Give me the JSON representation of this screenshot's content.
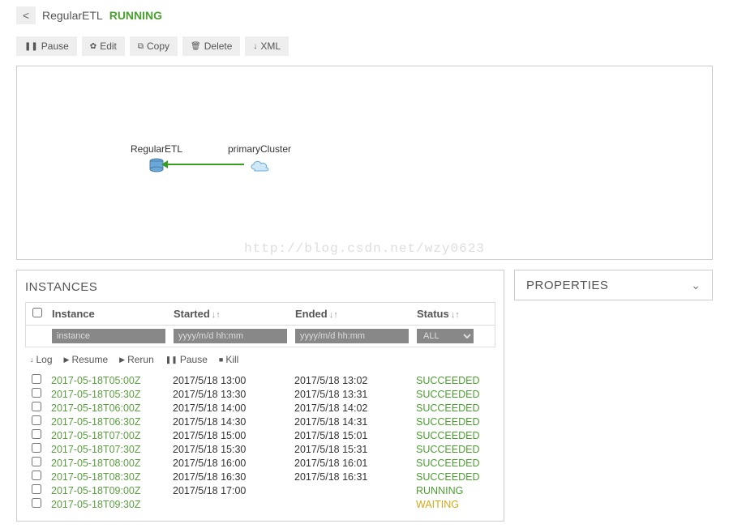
{
  "header": {
    "back_icon": "<",
    "feed_name": "RegularETL",
    "feed_status": "RUNNING"
  },
  "toolbar": {
    "pause": "Pause",
    "edit": "Edit",
    "copy": "Copy",
    "delete": "Delete",
    "xml": "XML"
  },
  "diagram": {
    "node1": "RegularETL",
    "node2": "primaryCluster",
    "watermark": "http://blog.csdn.net/wzy0623"
  },
  "instances_panel": {
    "title": "INSTANCES",
    "columns": {
      "instance": "Instance",
      "started": "Started",
      "ended": "Ended",
      "status": "Status"
    },
    "filters": {
      "instance_placeholder": "instance",
      "started_placeholder": "yyyy/m/d hh:mm",
      "ended_placeholder": "yyyy/m/d hh:mm",
      "status_value": "ALL"
    },
    "actions": {
      "log": "Log",
      "resume": "Resume",
      "rerun": "Rerun",
      "pause": "Pause",
      "kill": "Kill"
    },
    "rows": [
      {
        "id": "2017-05-18T05:00Z",
        "started": "2017/5/18 13:00",
        "ended": "2017/5/18 13:02",
        "status": "SUCCEEDED"
      },
      {
        "id": "2017-05-18T05:30Z",
        "started": "2017/5/18 13:30",
        "ended": "2017/5/18 13:31",
        "status": "SUCCEEDED"
      },
      {
        "id": "2017-05-18T06:00Z",
        "started": "2017/5/18 14:00",
        "ended": "2017/5/18 14:02",
        "status": "SUCCEEDED"
      },
      {
        "id": "2017-05-18T06:30Z",
        "started": "2017/5/18 14:30",
        "ended": "2017/5/18 14:31",
        "status": "SUCCEEDED"
      },
      {
        "id": "2017-05-18T07:00Z",
        "started": "2017/5/18 15:00",
        "ended": "2017/5/18 15:01",
        "status": "SUCCEEDED"
      },
      {
        "id": "2017-05-18T07:30Z",
        "started": "2017/5/18 15:30",
        "ended": "2017/5/18 15:31",
        "status": "SUCCEEDED"
      },
      {
        "id": "2017-05-18T08:00Z",
        "started": "2017/5/18 16:00",
        "ended": "2017/5/18 16:01",
        "status": "SUCCEEDED"
      },
      {
        "id": "2017-05-18T08:30Z",
        "started": "2017/5/18 16:30",
        "ended": "2017/5/18 16:31",
        "status": "SUCCEEDED"
      },
      {
        "id": "2017-05-18T09:00Z",
        "started": "2017/5/18 17:00",
        "ended": "",
        "status": "RUNNING"
      },
      {
        "id": "2017-05-18T09:30Z",
        "started": "",
        "ended": "",
        "status": "WAITING"
      }
    ]
  },
  "properties_panel": {
    "title": "PROPERTIES"
  }
}
